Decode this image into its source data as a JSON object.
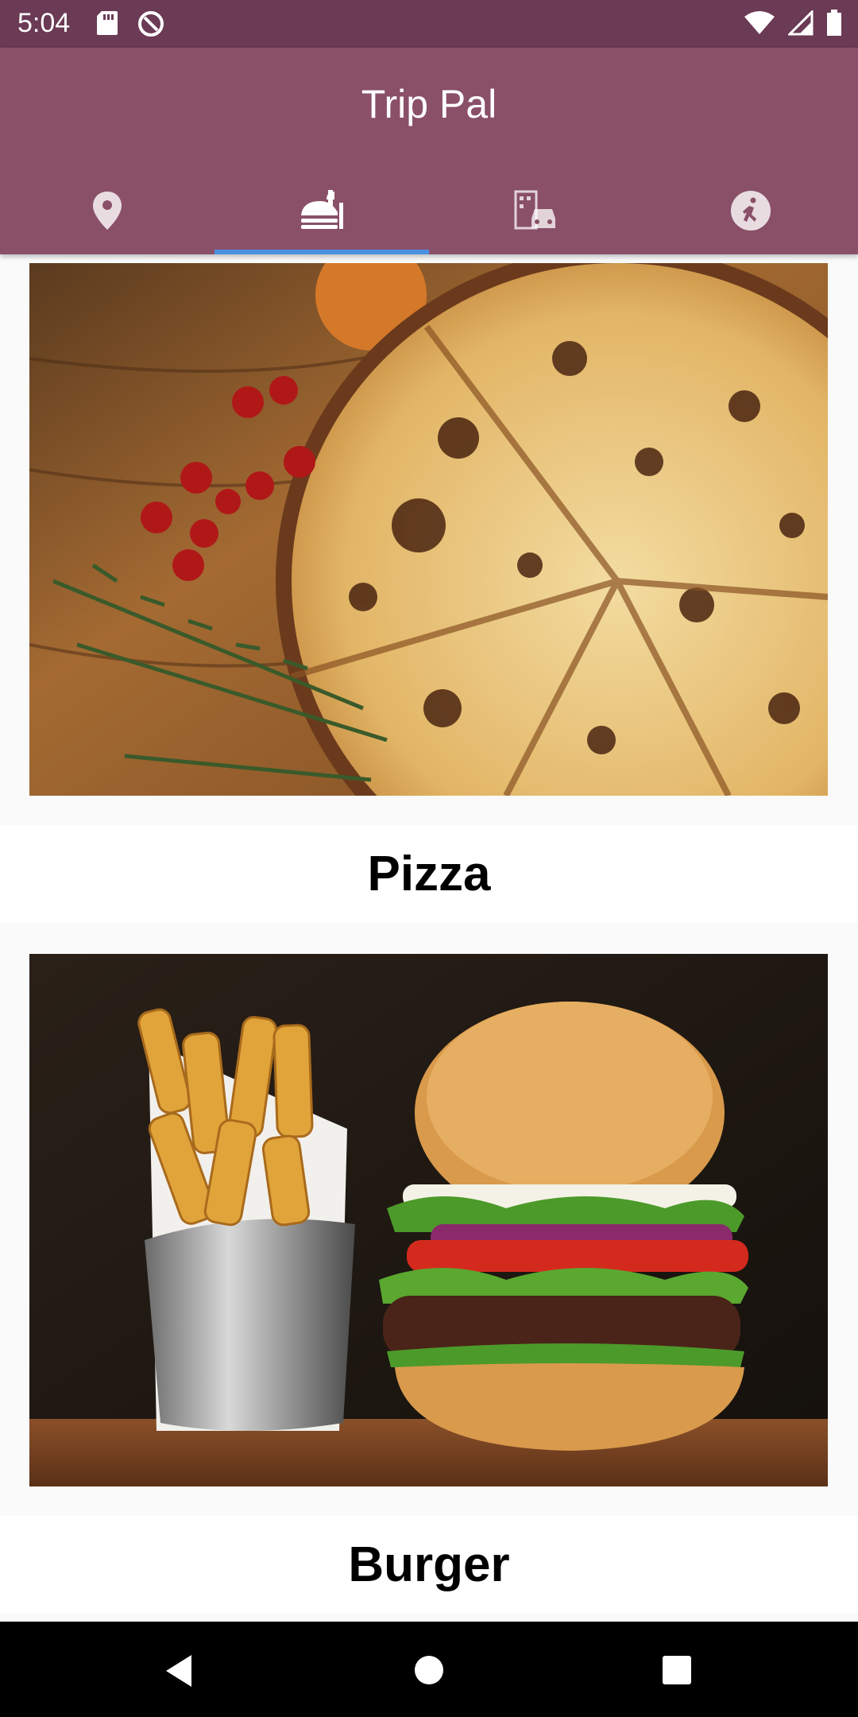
{
  "status_bar": {
    "time": "5:04",
    "left_icons": [
      "sd-card-icon",
      "data-saver-icon"
    ],
    "right_icons": [
      "wifi-icon",
      "signal-icon",
      "battery-icon"
    ]
  },
  "app_bar": {
    "title": "Trip Pal",
    "background": "#8a5068",
    "tabs": [
      {
        "icon": "location-pin-icon",
        "selected": false
      },
      {
        "icon": "restaurant-icon",
        "selected": true
      },
      {
        "icon": "hotel-taxi-icon",
        "selected": false
      },
      {
        "icon": "activity-run-icon",
        "selected": false
      }
    ],
    "indicator_color": "#4a90e2"
  },
  "list": {
    "items": [
      {
        "label": "Pizza",
        "image": "pizza-photo"
      },
      {
        "label": "Burger",
        "image": "burger-photo"
      }
    ]
  },
  "nav_bar": {
    "buttons": [
      "back-icon",
      "home-icon",
      "recents-icon"
    ]
  }
}
